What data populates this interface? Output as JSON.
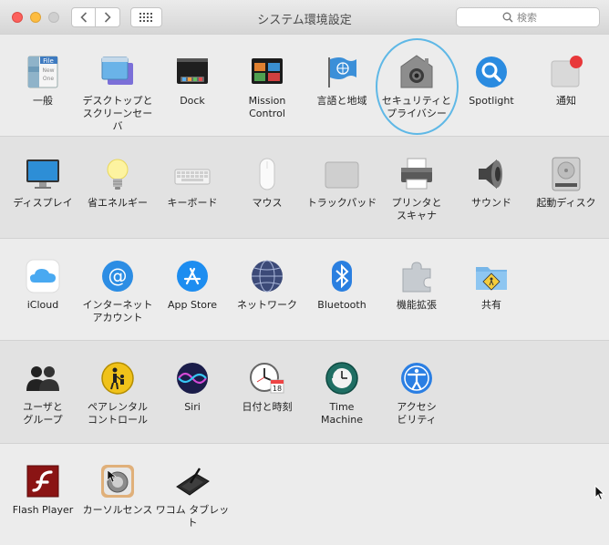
{
  "window": {
    "title": "システム環境設定"
  },
  "search": {
    "placeholder": "検索"
  },
  "sections": [
    {
      "items": [
        {
          "id": "general",
          "label": "一般"
        },
        {
          "id": "desktop",
          "label": "デスクトップと\nスクリーンセーバ"
        },
        {
          "id": "dock",
          "label": "Dock"
        },
        {
          "id": "mission",
          "label": "Mission\nControl"
        },
        {
          "id": "language",
          "label": "言語と地域"
        },
        {
          "id": "security",
          "label": "セキュリティと\nプライバシー"
        },
        {
          "id": "spotlight",
          "label": "Spotlight"
        },
        {
          "id": "notifications",
          "label": "通知"
        }
      ]
    },
    {
      "items": [
        {
          "id": "displays",
          "label": "ディスプレイ"
        },
        {
          "id": "energy",
          "label": "省エネルギー"
        },
        {
          "id": "keyboard",
          "label": "キーボード"
        },
        {
          "id": "mouse",
          "label": "マウス"
        },
        {
          "id": "trackpad",
          "label": "トラックパッド"
        },
        {
          "id": "printers",
          "label": "プリンタと\nスキャナ"
        },
        {
          "id": "sound",
          "label": "サウンド"
        },
        {
          "id": "startup",
          "label": "起動ディスク"
        }
      ]
    },
    {
      "items": [
        {
          "id": "icloud",
          "label": "iCloud"
        },
        {
          "id": "internet",
          "label": "インターネット\nアカウント"
        },
        {
          "id": "appstore",
          "label": "App Store"
        },
        {
          "id": "network",
          "label": "ネットワーク"
        },
        {
          "id": "bluetooth",
          "label": "Bluetooth"
        },
        {
          "id": "extensions",
          "label": "機能拡張"
        },
        {
          "id": "sharing",
          "label": "共有"
        }
      ]
    },
    {
      "items": [
        {
          "id": "users",
          "label": "ユーザと\nグループ"
        },
        {
          "id": "parental",
          "label": "ペアレンタル\nコントロール"
        },
        {
          "id": "siri",
          "label": "Siri"
        },
        {
          "id": "datetime",
          "label": "日付と時刻"
        },
        {
          "id": "timemachine",
          "label": "Time\nMachine"
        },
        {
          "id": "accessibility",
          "label": "アクセシ\nビリティ"
        }
      ]
    },
    {
      "items": [
        {
          "id": "flash",
          "label": "Flash Player"
        },
        {
          "id": "cursorsense",
          "label": "カーソルセンス"
        },
        {
          "id": "wacom",
          "label": "ワコム タブレット"
        }
      ]
    }
  ],
  "icons": {
    "general": "file-icon",
    "desktop": "desktop-icon",
    "dock": "dock-icon",
    "mission": "mission-control-icon",
    "language": "un-flag-icon",
    "security": "house-lock-icon",
    "spotlight": "magnifier-icon",
    "notifications": "notification-icon",
    "displays": "monitor-icon",
    "energy": "lightbulb-icon",
    "keyboard": "keyboard-icon",
    "mouse": "mouse-icon",
    "trackpad": "trackpad-icon",
    "printers": "printer-icon",
    "sound": "speaker-icon",
    "startup": "hard-drive-icon",
    "icloud": "cloud-icon",
    "internet": "at-sign-icon",
    "appstore": "app-store-icon",
    "network": "globe-icon",
    "bluetooth": "bluetooth-icon",
    "extensions": "puzzle-icon",
    "sharing": "shared-folder-icon",
    "users": "users-icon",
    "parental": "parental-icon",
    "siri": "siri-icon",
    "datetime": "clock-calendar-icon",
    "timemachine": "time-machine-icon",
    "accessibility": "accessibility-icon",
    "flash": "flash-icon",
    "cursorsense": "cursor-sense-icon",
    "wacom": "tablet-icon"
  },
  "icon_text": {
    "file_label": "File",
    "file_lines": [
      "New",
      "One"
    ],
    "calendar_day": "18"
  },
  "colors": {
    "accent": "#5fb8e6",
    "notification_badge": "#e8383a"
  }
}
